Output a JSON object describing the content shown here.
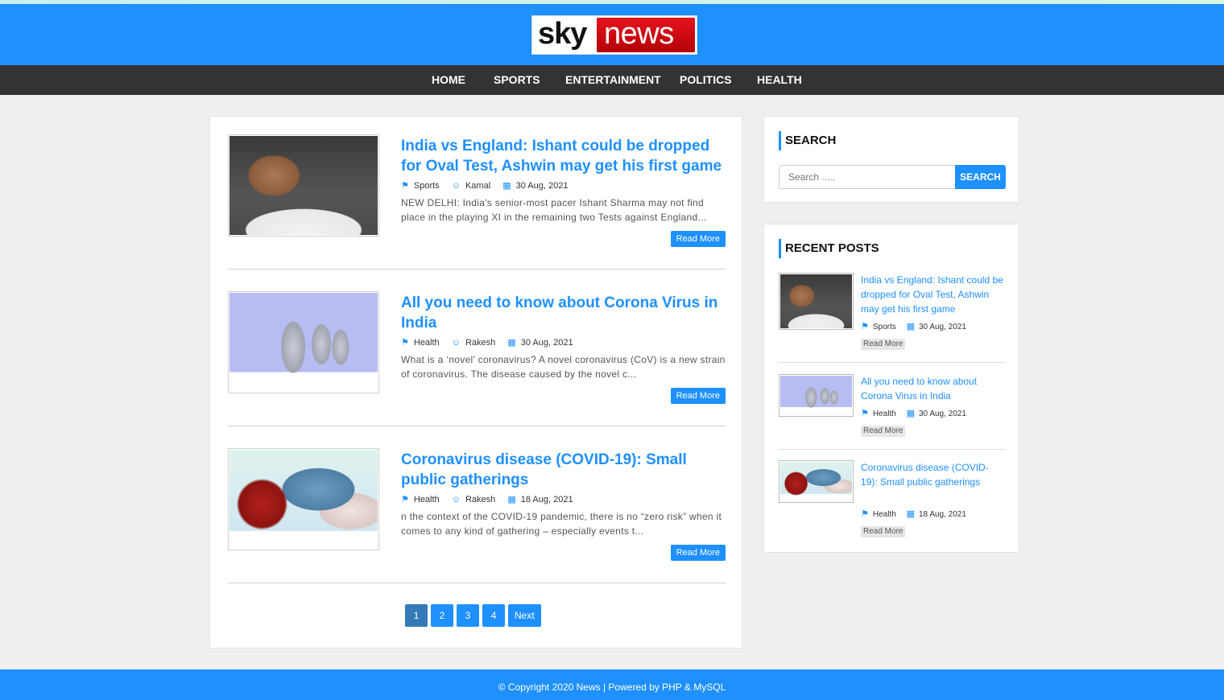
{
  "brand": {
    "logo_sky": "sky",
    "logo_news": "news"
  },
  "nav": [
    "HOME",
    "SPORTS",
    "ENTERTAINMENT",
    "POLITICS",
    "HEALTH"
  ],
  "posts": [
    {
      "title": "India vs England: Ishant could be dropped for Oval Test, Ashwin may get his first game",
      "category": "Sports",
      "author": "Kamal",
      "date": "30 Aug, 2021",
      "excerpt": "NEW DELHI: India's senior-most pacer Ishant Sharma may not find place in the playing XI in the remaining two Tests against England...",
      "read_more": "Read More"
    },
    {
      "title": "All you need to know about Corona Virus in India",
      "category": "Health",
      "author": "Rakesh",
      "date": "30 Aug, 2021",
      "excerpt": "What is a ‘novel’ coronavirus? A novel coronavirus (CoV) is a new strain of coronavirus. The disease caused by the novel c...",
      "read_more": "Read More"
    },
    {
      "title": "Coronavirus disease (COVID-19): Small public gatherings",
      "category": "Health",
      "author": "Rakesh",
      "date": "18 Aug, 2021",
      "excerpt": "n the context of the COVID-19 pandemic, there is no “zero risk” when it comes to any kind of gathering – especially events t...",
      "read_more": "Read More"
    }
  ],
  "pagination": {
    "pages": [
      "1",
      "2",
      "3",
      "4"
    ],
    "next": "Next",
    "active": "1"
  },
  "sidebar": {
    "search": {
      "title": "SEARCH",
      "placeholder": "Search .....",
      "button": "SEARCH"
    },
    "recent": {
      "title": "RECENT POSTS",
      "items": [
        {
          "title": "India vs England: Ishant could be dropped for Oval Test, Ashwin may get his first game",
          "category": "Sports",
          "date": "30 Aug, 2021",
          "read_more": "Read More"
        },
        {
          "title": "All you need to know about Corona Virus in India",
          "category": "Health",
          "date": "30 Aug, 2021",
          "read_more": "Read More"
        },
        {
          "title": "Coronavirus disease (COVID-19): Small public gatherings",
          "category": "Health",
          "date": "18 Aug, 2021",
          "read_more": "Read More"
        }
      ]
    }
  },
  "footer": {
    "text": "© Copyright 2020 News | Powered by PHP & MySQL"
  },
  "colors": {
    "accent": "#1e90ff",
    "navbar": "#333333",
    "background": "#efefef",
    "pagination_active": "#337ab7",
    "logo_red": "#e6141c"
  },
  "icons": {
    "category": "tags-icon",
    "author": "user-icon",
    "date": "calendar-icon"
  }
}
